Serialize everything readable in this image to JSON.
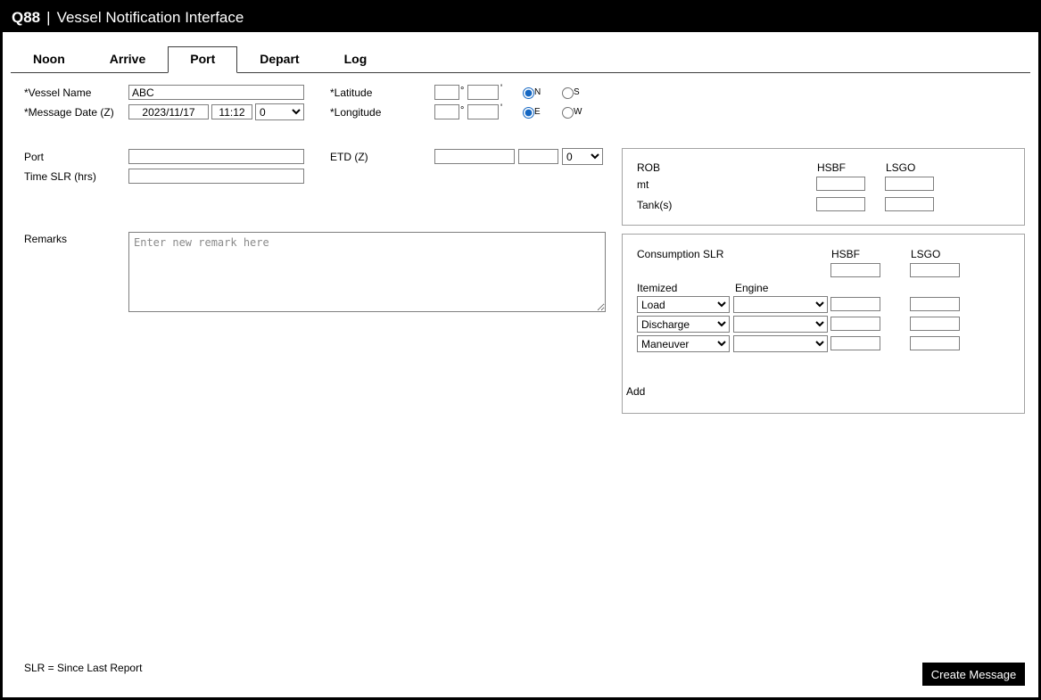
{
  "header": {
    "brand": "Q88",
    "sep": "|",
    "title": "Vessel Notification Interface"
  },
  "tabs": [
    {
      "label": "Noon",
      "active": false
    },
    {
      "label": "Arrive",
      "active": false
    },
    {
      "label": "Port",
      "active": true
    },
    {
      "label": "Depart",
      "active": false
    },
    {
      "label": "Log",
      "active": false
    }
  ],
  "form": {
    "symbols": {
      "degree": "°",
      "minute": "'"
    },
    "vessel_name": {
      "label": "*Vessel Name",
      "value": "ABC"
    },
    "message_date": {
      "label": "*Message Date (Z)",
      "date": "2023/11/17",
      "time": "11:12",
      "offset": "0"
    },
    "latitude": {
      "label": "*Latitude",
      "deg": "",
      "min": "",
      "north": "N",
      "south": "S",
      "selected": "N"
    },
    "longitude": {
      "label": "*Longitude",
      "deg": "",
      "min": "",
      "east": "E",
      "west": "W",
      "selected": "E"
    },
    "port": {
      "label": "Port",
      "value": ""
    },
    "etd": {
      "label": "ETD (Z)",
      "date": "",
      "time": "",
      "offset": "0"
    },
    "time_slr": {
      "label": "Time SLR (hrs)",
      "value": ""
    },
    "remarks": {
      "label": "Remarks",
      "placeholder": "Enter new remark here",
      "value": ""
    }
  },
  "rob": {
    "title": "ROB",
    "col1": "HSBF",
    "col2": "LSGO",
    "row1_label": "mt",
    "row2_label": "Tank(s)",
    "mt_hsbf": "",
    "mt_lsgo": "",
    "tanks_hsbf": "",
    "tanks_lsgo": ""
  },
  "consumption": {
    "title": "Consumption SLR",
    "col1": "HSBF",
    "col2": "LSGO",
    "slr_hsbf": "",
    "slr_lsgo": "",
    "itemized_label": "Itemized",
    "engine_label": "Engine",
    "rows": [
      {
        "itemized": "Load",
        "engine": "",
        "hsbf": "",
        "lsgo": ""
      },
      {
        "itemized": "Discharge",
        "engine": "",
        "hsbf": "",
        "lsgo": ""
      },
      {
        "itemized": "Maneuver",
        "engine": "",
        "hsbf": "",
        "lsgo": ""
      }
    ],
    "add_label": "Add"
  },
  "footer": {
    "note": "SLR = Since Last Report",
    "create_button": "Create Message"
  }
}
